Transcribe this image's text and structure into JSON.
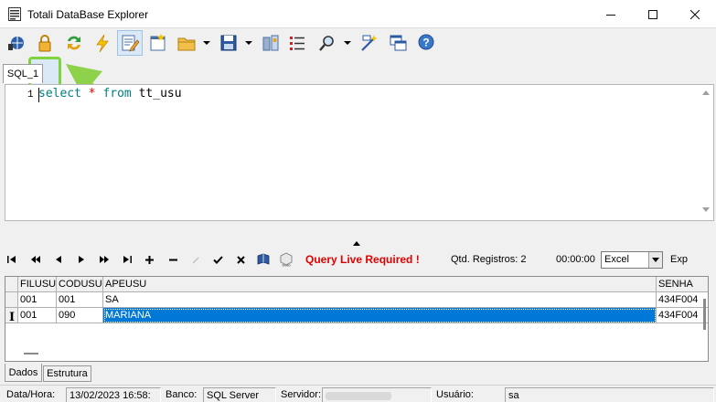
{
  "window": {
    "title": "Totali DataBase Explorer",
    "min": "—",
    "max": "☐",
    "close": "✕"
  },
  "toolbar": {
    "icons": [
      "connect-icon",
      "lock-icon",
      "refresh-icon",
      "execute-icon",
      "edit-icon",
      "new-icon",
      "open-folder-icon",
      "save-icon",
      "properties-icon",
      "list-icon",
      "find-icon",
      "wizard-icon",
      "windows-icon",
      "help-icon"
    ],
    "highlighted": "lock-icon",
    "highlight_color": "#7fd33e"
  },
  "editor": {
    "tab": "SQL_1",
    "line_number": "1",
    "code": {
      "kw1": "select",
      "op": "*",
      "kw2": "from",
      "table": "tt_usu"
    }
  },
  "navigator": {
    "query_live": "Query Live Required !",
    "qtd_registros": "Qtd. Registros: 2",
    "timer": "00:00:00",
    "export_format": "Excel",
    "export_label": "Exp",
    "accent_red": "#e00000"
  },
  "grid": {
    "columns": [
      "FILUSU",
      "CODUSU",
      "APEUSU",
      "SENHA"
    ],
    "rows": [
      {
        "filusu": "001",
        "codusu": "001",
        "apeusu": "SA",
        "senha": "434F004"
      },
      {
        "filusu": "001",
        "codusu": "090",
        "apeusu": "MARIANA",
        "senha": "434F004"
      }
    ],
    "selected_color": "#0078d7"
  },
  "bottom_tabs": {
    "dados": "Dados",
    "estrutura": "Estrutura"
  },
  "status": {
    "datahora_label": "Data/Hora:",
    "datahora": "13/02/2023 16:58:",
    "banco_label": "Banco:",
    "banco": "SQL Server",
    "servidor_label": "Servidor:",
    "usuario_label": "Usuário:",
    "usuario": "sa"
  }
}
